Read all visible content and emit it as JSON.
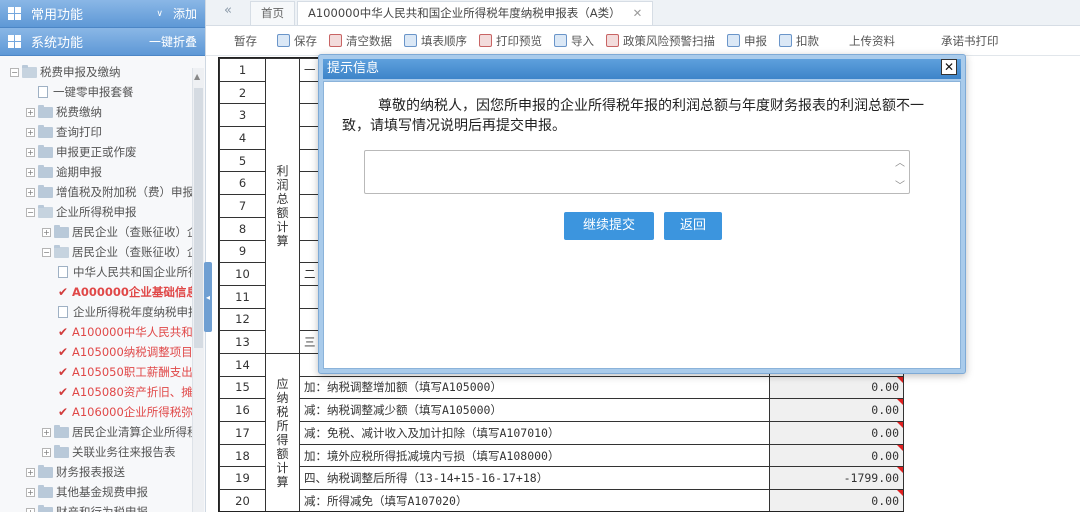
{
  "sidebar": {
    "common": {
      "title": "常用功能",
      "action": "添加"
    },
    "system": {
      "title": "系统功能",
      "action": "一键折叠"
    },
    "tree": [
      {
        "label": "税费申报及缴纳",
        "level": 0,
        "type": "folder-open",
        "toggle": "−"
      },
      {
        "label": "一键零申报套餐",
        "level": 1,
        "type": "doc"
      },
      {
        "label": "税费缴纳",
        "level": 1,
        "type": "folder",
        "toggle": "+"
      },
      {
        "label": "查询打印",
        "level": 1,
        "type": "folder",
        "toggle": "+"
      },
      {
        "label": "申报更正或作废",
        "level": 1,
        "type": "folder",
        "toggle": "+"
      },
      {
        "label": "逾期申报",
        "level": 1,
        "type": "folder",
        "toggle": "+"
      },
      {
        "label": "增值税及附加税（费）申报",
        "level": 1,
        "type": "folder",
        "toggle": "+"
      },
      {
        "label": "企业所得税申报",
        "level": 1,
        "type": "folder-open",
        "toggle": "−"
      },
      {
        "label": "居民企业（查账征收）企",
        "level": 2,
        "type": "folder",
        "toggle": "+"
      },
      {
        "label": "居民企业（查账征收）企",
        "level": 2,
        "type": "folder-open",
        "toggle": "−"
      },
      {
        "label": "中华人民共和国企业所得",
        "level": 3,
        "type": "doc"
      },
      {
        "label": "A000000企业基础信息",
        "level": 3,
        "type": "check",
        "style": "red"
      },
      {
        "label": "企业所得税年度纳税申报",
        "level": 3,
        "type": "doc"
      },
      {
        "label": "A100000中华人民共和",
        "level": 3,
        "type": "check",
        "style": "red2"
      },
      {
        "label": "A105000纳税调整项目",
        "level": 3,
        "type": "check",
        "style": "red2"
      },
      {
        "label": "A105050职工薪酬支出",
        "level": 3,
        "type": "check",
        "style": "red2"
      },
      {
        "label": "A105080资产折旧、摊",
        "level": 3,
        "type": "check",
        "style": "red2"
      },
      {
        "label": "A106000企业所得税弥",
        "level": 3,
        "type": "check",
        "style": "red2"
      },
      {
        "label": "居民企业清算企业所得税",
        "level": 2,
        "type": "folder",
        "toggle": "+"
      },
      {
        "label": "关联业务往来报告表",
        "level": 2,
        "type": "folder",
        "toggle": "+"
      },
      {
        "label": "财务报表报送",
        "level": 1,
        "type": "folder",
        "toggle": "+"
      },
      {
        "label": "其他基金规费申报",
        "level": 1,
        "type": "folder",
        "toggle": "+"
      },
      {
        "label": "财产和行为税申报",
        "level": 1,
        "type": "folder",
        "toggle": "+"
      }
    ]
  },
  "tabs": {
    "nav": "«",
    "home": "首页",
    "active": "A100000中华人民共和国企业所得税年度纳税申报表（A类）",
    "close": "✕"
  },
  "toolbar": {
    "stash": "暂存",
    "save": "保存",
    "clear": "清空数据",
    "fill_order": "填表顺序",
    "print_preview": "打印预览",
    "import": "导入",
    "risk_scan": "政策风险预警扫描",
    "declare": "申报",
    "deduct": "扣款",
    "upload": "上传资料",
    "commitment_print": "承诺书打印"
  },
  "table": {
    "cat_profit": "利润总额计算",
    "cat_taxable": "应纳税所得额计算",
    "rows": [
      {
        "no": "1",
        "item": "一",
        "value": ""
      },
      {
        "no": "2",
        "item": "",
        "value": ""
      },
      {
        "no": "3",
        "item": "",
        "value": ""
      },
      {
        "no": "4",
        "item": "",
        "value": ""
      },
      {
        "no": "5",
        "item": "",
        "value": ""
      },
      {
        "no": "6",
        "item": "",
        "value": ""
      },
      {
        "no": "7",
        "item": "",
        "value": ""
      },
      {
        "no": "8",
        "item": "",
        "value": ""
      },
      {
        "no": "9",
        "item": "",
        "value": ""
      },
      {
        "no": "10",
        "item": "二",
        "value": ""
      },
      {
        "no": "11",
        "item": "",
        "value": ""
      },
      {
        "no": "12",
        "item": "",
        "value": ""
      },
      {
        "no": "13",
        "item": "三",
        "value": ""
      },
      {
        "no": "14",
        "item": "",
        "value": ""
      },
      {
        "no": "15",
        "item": "加：纳税调整增加额（填写A105000）",
        "value": "0.00"
      },
      {
        "no": "16",
        "item": "减：纳税调整减少额（填写A105000）",
        "value": "0.00"
      },
      {
        "no": "17",
        "item": "减：免税、减计收入及加计扣除（填写A107010）",
        "value": "0.00"
      },
      {
        "no": "18",
        "item": "加：境外应税所得抵减境内亏损（填写A108000）",
        "value": "0.00"
      },
      {
        "no": "19",
        "item": "四、纳税调整后所得（13-14+15-16-17+18）",
        "value": "-1799.00"
      },
      {
        "no": "20",
        "item": "减：所得减免（填写A107020）",
        "value": "0.00"
      }
    ]
  },
  "dialog": {
    "title": "提示信息",
    "close": "✕",
    "message": "尊敬的纳税人，因您所申报的企业所得税年报的利润总额与年度财务报表的利润总额不一致，请填写情况说明后再提交申报。",
    "input_value": "",
    "continue": "继续提交",
    "back": "返回"
  }
}
